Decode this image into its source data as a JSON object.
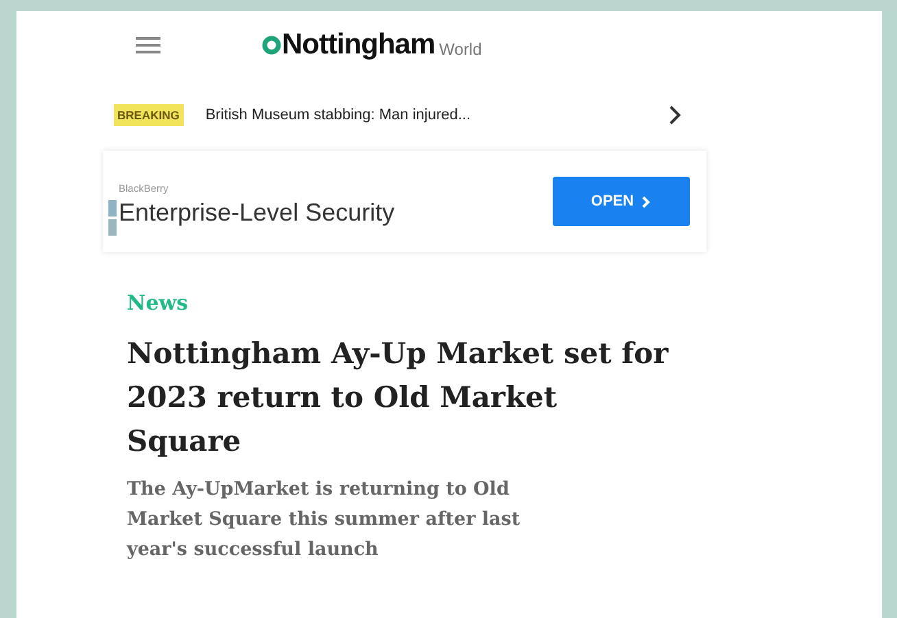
{
  "header": {
    "logo_main": "Nottingham",
    "logo_suffix": "World"
  },
  "breaking": {
    "badge": "BREAKING",
    "headline": "British Museum stabbing: Man injured..."
  },
  "ad": {
    "advertiser": "BlackBerry",
    "title": "Enterprise-Level Security",
    "button": "OPEN"
  },
  "article": {
    "category": "News",
    "headline": "Nottingham Ay-Up Market set for 2023 return to Old Market Square",
    "summary": "The Ay-UpMarket is returning to Old Market Square this summer after last year's successful launch"
  }
}
